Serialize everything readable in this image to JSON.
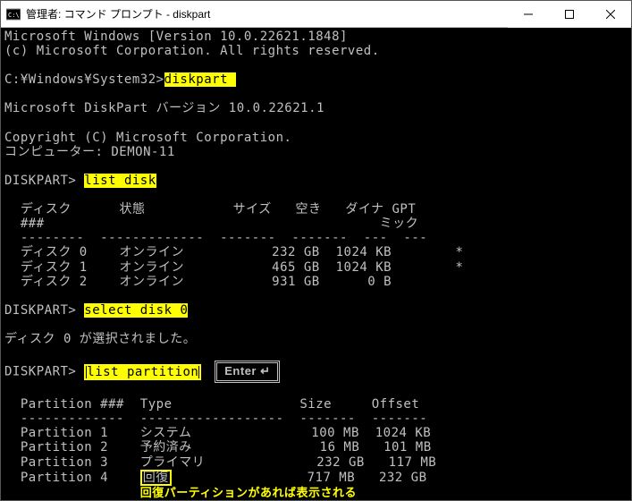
{
  "window": {
    "title": "管理者: コマンド プロンプト - diskpart"
  },
  "content": {
    "line1": "Microsoft Windows [Version 10.0.22621.1848]",
    "line2": "(c) Microsoft Corporation. All rights reserved.",
    "prompt_path": "C:¥Windows¥System32>",
    "cmd_diskpart": "diskpart ",
    "dp_version": "Microsoft DiskPart バージョン 10.0.22621.1",
    "dp_copyright": "Copyright (C) Microsoft Corporation.",
    "dp_computer": "コンピューター: DEMON-11",
    "dp_prompt": "DISKPART> ",
    "cmd_listdisk": "list disk",
    "disk_header": "  ディスク      状態           サイズ   空き   ダイナ GPT",
    "disk_header2": "  ###                                          ミック",
    "disk_divider": "  --------  -------------  -------  -------  ---  ---",
    "disk_row0": "  ディスク 0    オンライン           232 GB  1024 KB        *",
    "disk_row1": "  ディスク 1    オンライン           465 GB  1024 KB        *",
    "disk_row2": "  ディスク 2    オンライン           931 GB      0 B",
    "cmd_select": "select disk 0",
    "select_result": "ディスク 0 が選択されました。",
    "cmd_listpart": "list partition",
    "enter_label": "Enter ↵",
    "part_header": "  Partition ###  Type                Size     Offset",
    "part_divider": "  -------------  ------------------  -------  -------",
    "part_row1": "  Partition 1    システム               100 MB  1024 KB",
    "part_row2": "  Partition 2    予約済み                16 MB   101 MB",
    "part_row3": "  Partition 3    プライマリ              232 GB   117 MB",
    "part_row4a": "  Partition 4    ",
    "part_row4b": "回復",
    "part_row4c": "                 717 MB   232 GB",
    "annotation": "回復パーティションがあれば表示される"
  }
}
